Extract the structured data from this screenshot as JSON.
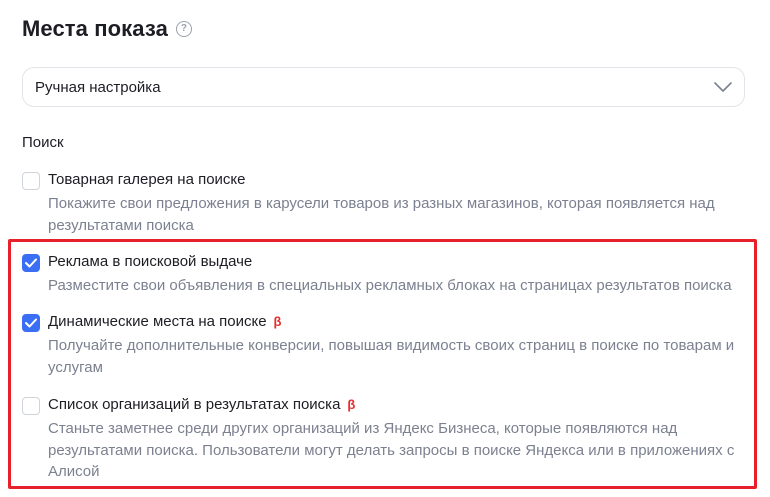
{
  "header": {
    "title": "Места показа",
    "help_icon": "?"
  },
  "placement_select": {
    "value": "Ручная настройка"
  },
  "section": {
    "label": "Поиск"
  },
  "options": [
    {
      "title": "Товарная галерея на поиске",
      "description": "Покажите свои предложения в карусели товаров из разных магазинов, которая появляется над результатами поиска",
      "checked": false,
      "beta": ""
    },
    {
      "title": "Реклама в поисковой выдаче",
      "description": "Разместите свои объявления в специальных рекламных блоках на страницах результатов поиска",
      "checked": true,
      "beta": ""
    },
    {
      "title": "Динамические места на поиске",
      "description": "Получайте дополнительные конверсии, повышая видимость своих страниц в поиске по товарам и услугам",
      "checked": true,
      "beta": "β"
    },
    {
      "title": "Список организаций в результатах поиска",
      "description": "Станьте заметнее среди других организаций из Яндекс Бизнеса, которые появляются над результатами поиска. Пользователи могут делать запросы в поиске Яндекса или в приложениях с Алисой",
      "checked": false,
      "beta": "β"
    }
  ],
  "colors": {
    "accent": "#3a6ff5",
    "beta": "#e62b2b",
    "highlight": "#e8202a",
    "description": "#7b8190"
  }
}
